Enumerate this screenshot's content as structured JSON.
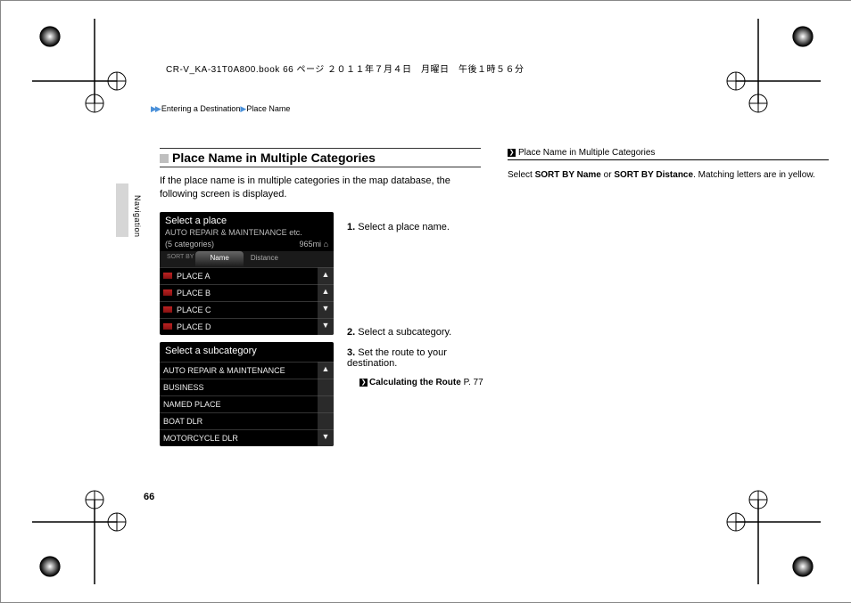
{
  "meta": {
    "prodLine": "CR-V_KA-31T0A800.book  66 ページ  ２０１１年７月４日　月曜日　午後１時５６分",
    "breadcrumb": {
      "arrows": "▶▶",
      "a": "Entering a Destination",
      "b": "Place Name"
    },
    "sideLabel": "Navigation",
    "pageNumber": "66"
  },
  "section": {
    "title": "Place Name in Multiple Categories",
    "intro": "If the place name is in multiple categories in the map database, the following screen is displayed."
  },
  "screenshotA": {
    "title": "Select a place",
    "subtitleLeft": "AUTO REPAIR & MAINTENANCE etc.",
    "subtitleCount": "(5 categories)",
    "subtitleRight": "965mi",
    "sortLabel": "SORT BY",
    "tabs": {
      "name": "Name",
      "distance": "Distance"
    },
    "rows": [
      "PLACE A",
      "PLACE B",
      "PLACE C",
      "PLACE D"
    ],
    "scroll": [
      "▲",
      "▲",
      "▼",
      "▼"
    ]
  },
  "screenshotB": {
    "title": "Select a subcategory",
    "rows": [
      "AUTO REPAIR & MAINTENANCE",
      "BUSINESS",
      "NAMED PLACE",
      "BOAT DLR",
      "MOTORCYCLE DLR"
    ],
    "scroll": [
      "▲",
      "",
      "",
      "",
      "▼"
    ]
  },
  "steps": {
    "s1": {
      "n": "1.",
      "t": "Select a place name."
    },
    "s2": {
      "n": "2.",
      "t": "Select a subcategory."
    },
    "s3": {
      "n": "3.",
      "t": "Set the route to your destination."
    },
    "xref": {
      "label": "Calculating the Route",
      "page": "P. 77"
    }
  },
  "note": {
    "title": "Place Name in Multiple Categories",
    "body_a": "Select ",
    "body_b": "SORT BY Name",
    "body_c": " or ",
    "body_d": "SORT BY Distance",
    "body_e": ". Matching letters are in yellow."
  }
}
